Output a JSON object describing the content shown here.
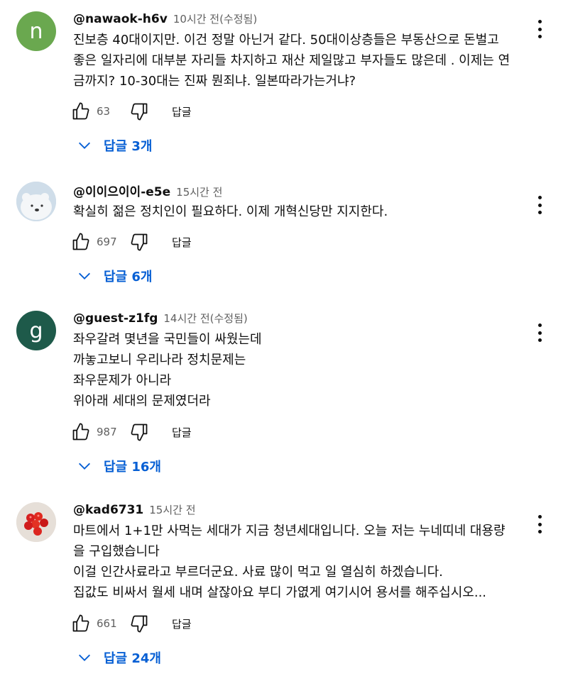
{
  "reply_label": "답글",
  "comments": [
    {
      "author": "@nawaok-h6v",
      "time": "10시간 전(수정됨)",
      "avatar_letter": "n",
      "avatar_color": "#6aa84f",
      "lines": [
        "진보층 40대이지만. 이건 정말 아닌거 같다. 50대이상층들은 부동산으로 돈벌고",
        "좋은 일자리에 대부분 자리들 차지하고 재산 제일많고 부자들도 많은데 . 이제는 연",
        "금까지? 10-30대는 진짜 뭔죄냐. 일본따라가는거냐?"
      ],
      "likes": "63",
      "replies_label": "답글 3개"
    },
    {
      "author": "@이이으이이-e5e",
      "time": "15시간 전",
      "avatar_letter": "",
      "avatar_color": "#c8d8e8",
      "lines": [
        "확실히 젊은 정치인이 필요하다. 이제 개혁신당만 지지한다."
      ],
      "likes": "697",
      "replies_label": "답글 6개"
    },
    {
      "author": "@guest-z1fg",
      "time": "14시간 전(수정됨)",
      "avatar_letter": "g",
      "avatar_color": "#1e5a4a",
      "lines": [
        "좌우갈려 몇년을 국민들이 싸웠는데",
        "까놓고보니 우리나라 정치문제는",
        "좌우문제가 아니라",
        "위아래 세대의 문제였더라"
      ],
      "likes": "987",
      "replies_label": "답글 16개"
    },
    {
      "author": "@kad6731",
      "time": "15시간 전",
      "avatar_letter": "",
      "avatar_color": "#e8e2dc",
      "lines": [
        "마트에서 1+1만 사먹는 세대가 지금 청년세대입니다. 오늘 저는 누네띠네 대용량",
        "을 구입했습니다",
        "이걸 인간사료라고 부르더군요. 사료 많이 먹고 일 열심히 하겠습니다.",
        "집값도 비싸서 월세 내며 살잖아요 부디 가엾게 여기시어 용서를 해주십시오..."
      ],
      "likes": "661",
      "replies_label": "답글 24개"
    }
  ]
}
